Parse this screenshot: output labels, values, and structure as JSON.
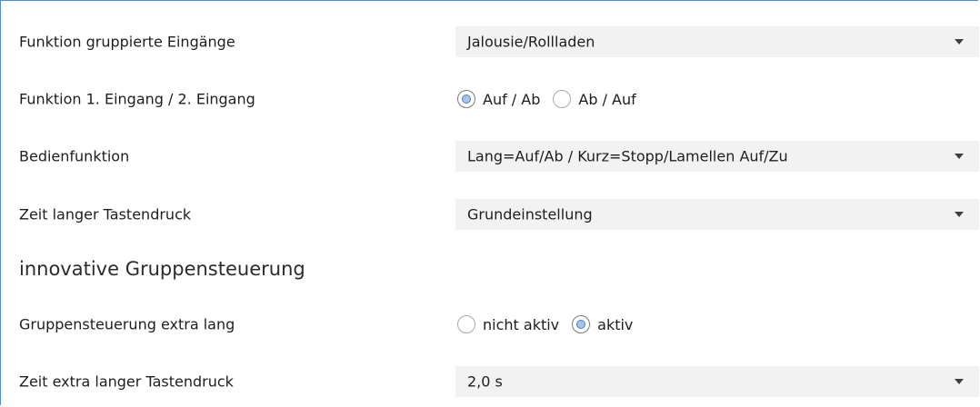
{
  "rows": {
    "funktion_gruppiert": {
      "label": "Funktion gruppierte Eingänge",
      "value": "Jalousie/Rollladen"
    },
    "funktion_eingang": {
      "label": "Funktion 1. Eingang / 2. Eingang",
      "options": [
        {
          "label": "Auf / Ab",
          "checked": true
        },
        {
          "label": "Ab / Auf",
          "checked": false
        }
      ]
    },
    "bedienfunktion": {
      "label": "Bedienfunktion",
      "value": "Lang=Auf/Ab / Kurz=Stopp/Lamellen Auf/Zu"
    },
    "zeit_langer": {
      "label": "Zeit langer Tastendruck",
      "value": "Grundeinstellung"
    },
    "section": {
      "title": "innovative Gruppensteuerung"
    },
    "gruppensteuerung": {
      "label": "Gruppensteuerung extra lang",
      "options": [
        {
          "label": "nicht aktiv",
          "checked": false
        },
        {
          "label": "aktiv",
          "checked": true
        }
      ]
    },
    "zeit_extra": {
      "label": "Zeit extra langer Tastendruck",
      "value": "2,0 s"
    }
  },
  "colors": {
    "border_accent": "#5a89c8",
    "select_background": "#f2f2f2",
    "radio_checked_fill": "#a7c3e6"
  }
}
